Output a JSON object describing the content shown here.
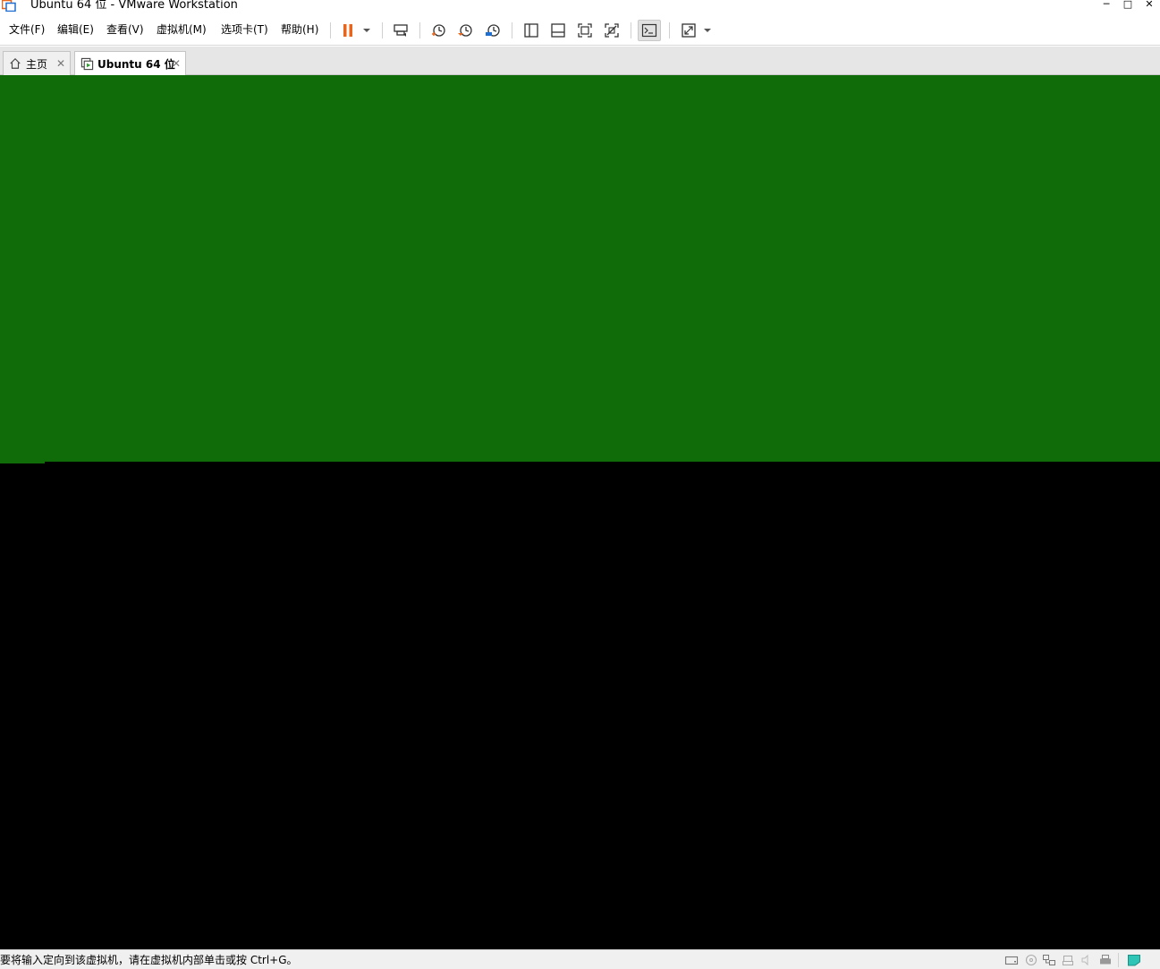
{
  "window": {
    "title": "Ubuntu 64 位 - VMware Workstation",
    "minimize": "─",
    "maximize": "□",
    "close": "✕"
  },
  "menu": {
    "file": "文件(F)",
    "edit": "编辑(E)",
    "view": "查看(V)",
    "vm": "虚拟机(M)",
    "tabs": "选项卡(T)",
    "help": "帮助(H)"
  },
  "toolbar_icons": [
    "pause-icon",
    "dropdown-arrow-icon",
    "send-ctrl-alt-del-icon",
    "snapshot-take-icon",
    "snapshot-revert-icon",
    "snapshot-manager-icon",
    "show-library-icon",
    "show-thumbnail-bar-icon",
    "full-screen-icon",
    "unity-icon",
    "console-view-icon",
    "stretch-guest-icon",
    "dropdown-arrow-icon"
  ],
  "tabs": [
    {
      "label": "主页",
      "icon": "home-icon",
      "close": "✕"
    },
    {
      "label": "Ubuntu 64 位",
      "icon": "vm-running-icon",
      "close": "✕"
    }
  ],
  "vm_screen": {
    "top_color": "#106b09",
    "bottom_color": "#000000"
  },
  "status": {
    "message": "要将输入定向到该虚拟机，请在虚拟机内部单击或按 Ctrl+G。",
    "icons": [
      "hard-disk-icon",
      "cd-dvd-icon",
      "network-adapter-icon",
      "usb-icon",
      "sound-icon",
      "printer-icon",
      "message-log-icon"
    ]
  },
  "colors": {
    "accent_orange": "#e8661c",
    "guest_green": "#106b09",
    "status_teal": "#2ec4b6"
  }
}
